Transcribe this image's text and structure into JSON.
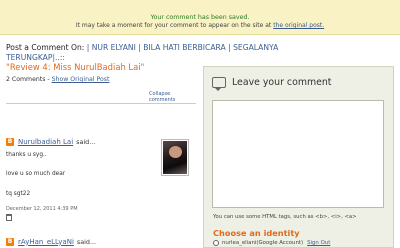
{
  "notice": {
    "saved": "Your comment has been saved.",
    "moment_prefix": "It may take a moment for your comment to appear on the site at",
    "original_post_link": "the original post."
  },
  "post": {
    "on_label": "Post a Comment On:",
    "blog_title_part1": "| NUR ELYANI | BILA HATI BERBICARA | SEGALANYA",
    "blog_title_part2": "TERUNGKAP|..::"
  },
  "review": {
    "title": "\"Review 4: Miss NurulBadiah Lai\"",
    "count": "2 Comments -",
    "show_original": "Show Original Post",
    "collapse": "Collapse comments"
  },
  "comments": [
    {
      "author": "Nurulbadiah Lai",
      "said": "said...",
      "lines": [
        "thanks u syg..",
        "love u so much dear",
        "tq sgt22"
      ],
      "date": "December 12, 2011 4:39 PM"
    },
    {
      "author": "rAyHan_eLLyaNi",
      "said": "said..."
    }
  ],
  "panel": {
    "leave_label": "Leave your comment",
    "textarea_value": "",
    "html_hint": "You can use some HTML tags, such as <b>, <i>, <a>",
    "choose_identity": "Choose an identity",
    "identity_text": "nurlea_eliani(Google Account)",
    "sign_out": "Sign Out"
  },
  "icons": {
    "blogger": "blogger-icon",
    "trash": "trash-icon",
    "chat": "comment-bubble-icon"
  },
  "colors": {
    "notice_bg": "#f8f2c4",
    "saved_text": "#2f7c23",
    "accent_orange": "#e06a20",
    "link_blue": "#3b5d91",
    "panel_bg": "#eef0e6"
  }
}
